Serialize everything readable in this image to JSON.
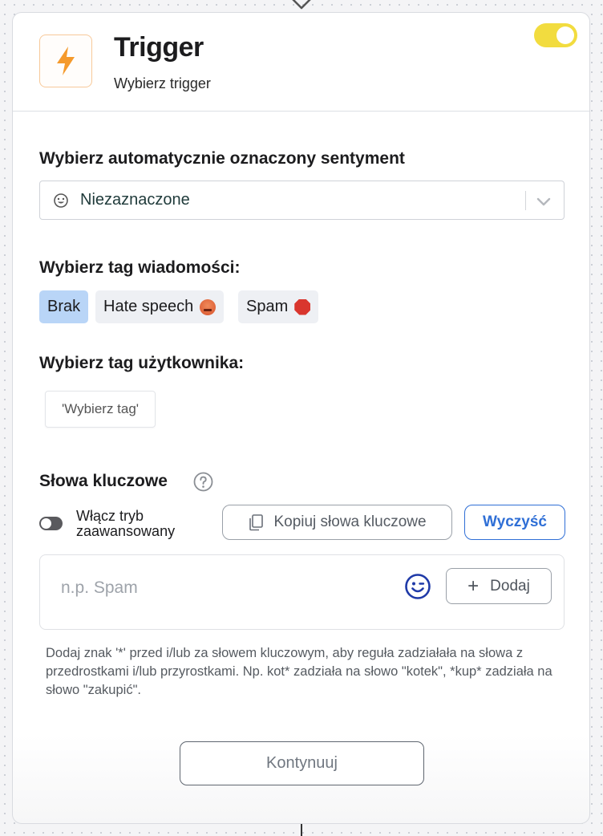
{
  "header": {
    "title": "Trigger",
    "subtitle": "Wybierz trigger",
    "enabled": true
  },
  "sentiment": {
    "label": "Wybierz automatycznie oznaczony sentyment",
    "selected": "Niezaznaczone"
  },
  "message_tag": {
    "label": "Wybierz tag wiadomości:",
    "options": [
      "Brak",
      "Hate speech",
      "Spam"
    ],
    "selected": "Brak"
  },
  "user_tag": {
    "label": "Wybierz tag użytkownika:",
    "select_text": "'Wybierz tag'"
  },
  "keywords": {
    "label": "Słowa kluczowe",
    "advanced_mode_label": "Włącz tryb zaawansowany",
    "advanced_mode_on": false,
    "copy_label": "Kopiuj słowa kluczowe",
    "clear_label": "Wyczyść",
    "input_placeholder": "n.p. Spam",
    "input_value": "",
    "add_label": "Dodaj",
    "hint": "Dodaj znak '*' przed i/lub za słowem kluczowym, aby reguła zadziałała na słowa z przedrostkami i/lub przyrostkami. Np. kot* zadziała na słowo \"kotek\", *kup* zadziała na słowo \"zakupić\"."
  },
  "continue_label": "Kontynuuj",
  "colors": {
    "toggle_on": "#f2dc3f",
    "chip_active": "#b9d5f7",
    "primary_blue": "#2f6fd6",
    "icon_orange": "#f59a2c"
  }
}
